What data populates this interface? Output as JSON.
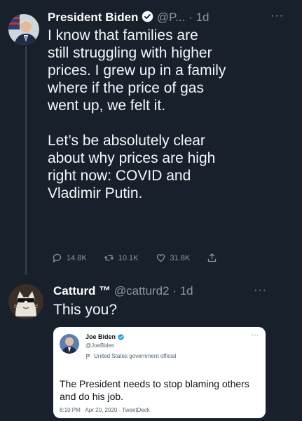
{
  "tweet1": {
    "name": "President Biden",
    "handle_time": "@P... · 1d",
    "more": "···",
    "text": "I know that families are\nstill struggling with higher\nprices. I grew up in a family\nwhere if the price of gas\nwent up, we felt it.\n\nLet’s be absolutely clear\nabout why prices are high\nright now: COVID and\nVladimir Putin.",
    "replies": "14.8K",
    "retweets": "10.1K",
    "likes": "31.8K"
  },
  "tweet2": {
    "name": "Catturd ™",
    "handle_time": "@catturd2 · 1d",
    "more": "···",
    "text": "This you?"
  },
  "quote": {
    "name": "Joe Biden",
    "handle": "@JoeBiden",
    "label": "United States government official",
    "more": "···",
    "text": "The President needs to stop blaming others and do his job.",
    "time": "8:10 PM · Apr 20, 2020 · TweetDeck"
  },
  "colors": {
    "background": "#17202b",
    "verified": "#1d9bf0",
    "muted": "#8b98a5"
  }
}
